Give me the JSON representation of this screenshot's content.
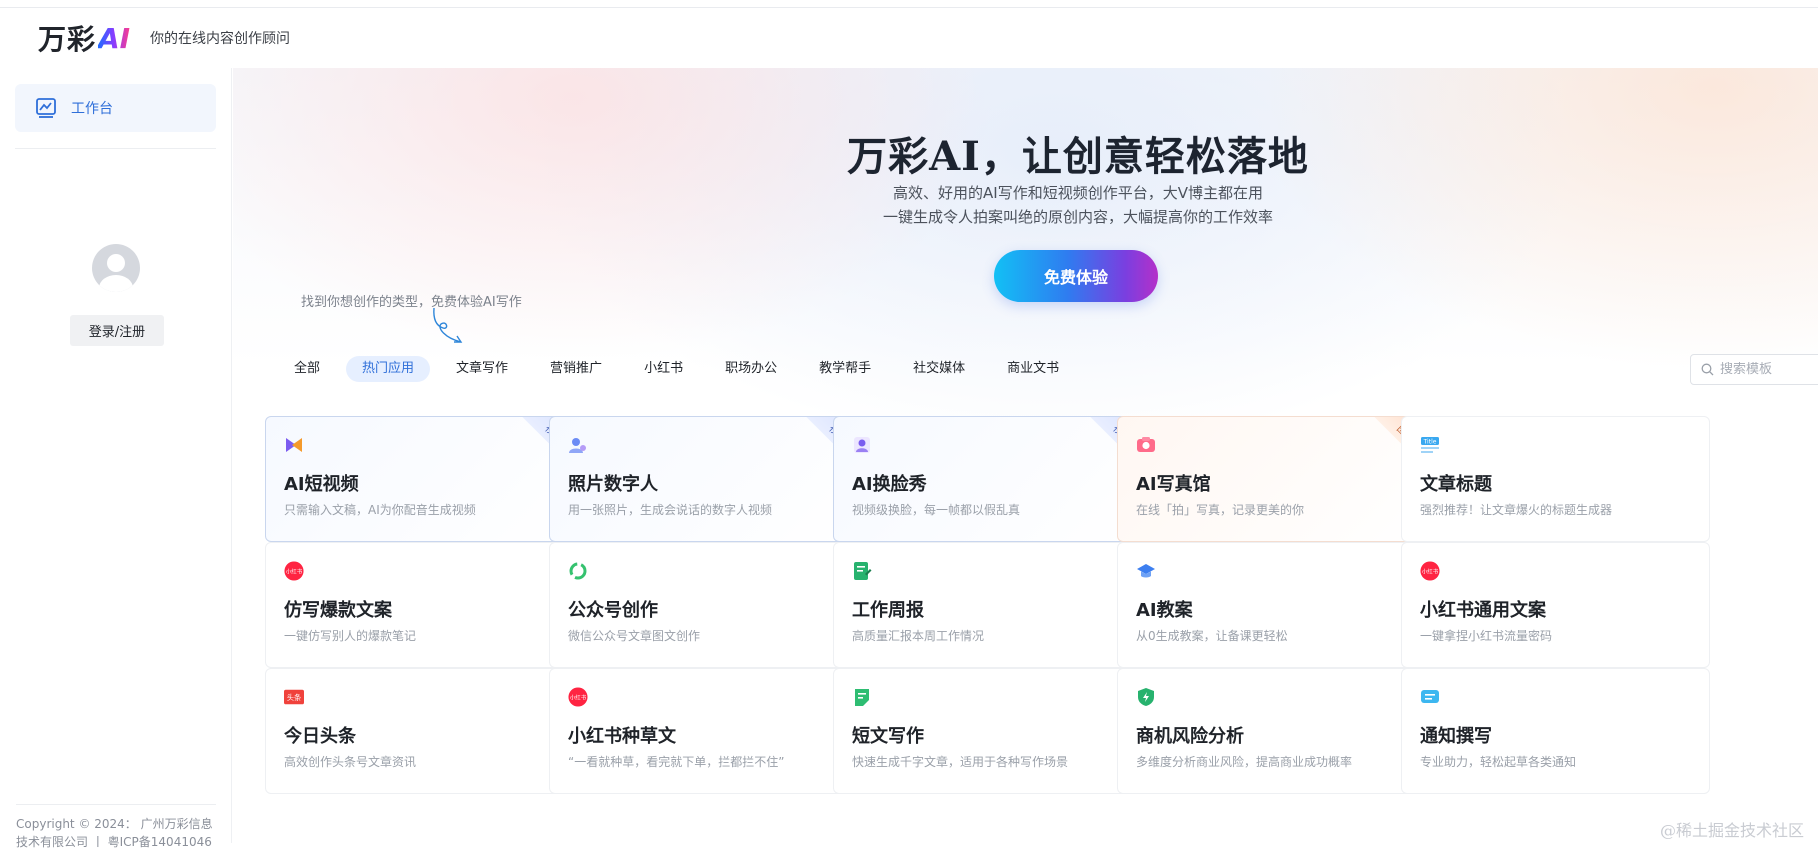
{
  "header": {
    "logo_text": "万彩",
    "logo_ai": "AI",
    "tagline": "你的在线内容创作顾问"
  },
  "sidebar": {
    "workbench_label": "工作台",
    "login_label": "登录/注册",
    "footer_line1": "Copyright © 2024： 广州万彩信息",
    "footer_line2": "技术有限公司 丨 粤ICP备14041046"
  },
  "hero": {
    "title": "万彩AI，让创意轻松落地",
    "subtitle1": "高效、好用的AI写作和短视频创作平台，大V博主都在用",
    "subtitle2": "一键生成令人拍案叫绝的原创内容，大幅提高你的工作效率",
    "cta_label": "免费体验",
    "hint": "找到你想创作的类型，免费体验AI写作"
  },
  "tabs": [
    "全部",
    "热门应用",
    "文章写作",
    "营销推广",
    "小红书",
    "职场办公",
    "教学帮手",
    "社交媒体",
    "商业文书"
  ],
  "active_tab": "热门应用",
  "search": {
    "placeholder": "搜索模板"
  },
  "cards": [
    {
      "title": "AI短视频",
      "desc": "只需输入文稿，AI为你配音生成视频",
      "badge": "视频",
      "icon": "video-play-icon",
      "style": "blue"
    },
    {
      "title": "照片数字人",
      "desc": "用一张照片，生成会说话的数字人视频",
      "badge": "视频",
      "icon": "digital-human-icon",
      "style": "blue"
    },
    {
      "title": "AI换脸秀",
      "desc": "视频级换脸，每一帧都以假乱真",
      "badge": "视频",
      "icon": "face-swap-icon",
      "style": "blue"
    },
    {
      "title": "AI写真馆",
      "desc": "在线「拍」写真，记录更美的你",
      "badge": "图片",
      "icon": "camera-icon",
      "style": "orange"
    },
    {
      "title": "文章标题",
      "desc": "强烈推荐！让文章爆火的标题生成器",
      "badge": "",
      "icon": "title-icon",
      "style": "plain"
    },
    {
      "title": "仿写爆款文案",
      "desc": "一键仿写别人的爆款笔记",
      "badge": "",
      "icon": "xiaohongshu-icon",
      "style": "plain"
    },
    {
      "title": "公众号创作",
      "desc": "微信公众号文章图文创作",
      "badge": "",
      "icon": "wechat-official-icon",
      "style": "plain"
    },
    {
      "title": "工作周报",
      "desc": "高质量汇报本周工作情况",
      "badge": "",
      "icon": "report-icon",
      "style": "plain"
    },
    {
      "title": "AI教案",
      "desc": "从0生成教案，让备课更轻松",
      "badge": "",
      "icon": "graduation-cap-icon",
      "style": "plain"
    },
    {
      "title": "小红书通用文案",
      "desc": "一键拿捏小红书流量密码",
      "badge": "",
      "icon": "xiaohongshu-icon",
      "style": "plain"
    },
    {
      "title": "今日头条",
      "desc": "高效创作头条号文章资讯",
      "badge": "",
      "icon": "toutiao-icon",
      "style": "plain"
    },
    {
      "title": "小红书种草文",
      "desc": "“一看就种草，看完就下单，拦都拦不住”",
      "badge": "",
      "icon": "xiaohongshu-icon",
      "style": "plain"
    },
    {
      "title": "短文写作",
      "desc": "快速生成千字文章，适用于各种写作场景",
      "badge": "",
      "icon": "note-icon",
      "style": "plain"
    },
    {
      "title": "商机风险分析",
      "desc": "多维度分析商业风险，提高商业成功概率",
      "badge": "",
      "icon": "shield-icon",
      "style": "plain"
    },
    {
      "title": "通知撰写",
      "desc": "专业助力，轻松起草各类通知",
      "badge": "",
      "icon": "message-icon",
      "style": "plain"
    }
  ],
  "icon_labels": {
    "xiaohongshu": "小红书",
    "toutiao": "头条",
    "title": "Title"
  },
  "watermark": "@稀土掘金技术社区"
}
